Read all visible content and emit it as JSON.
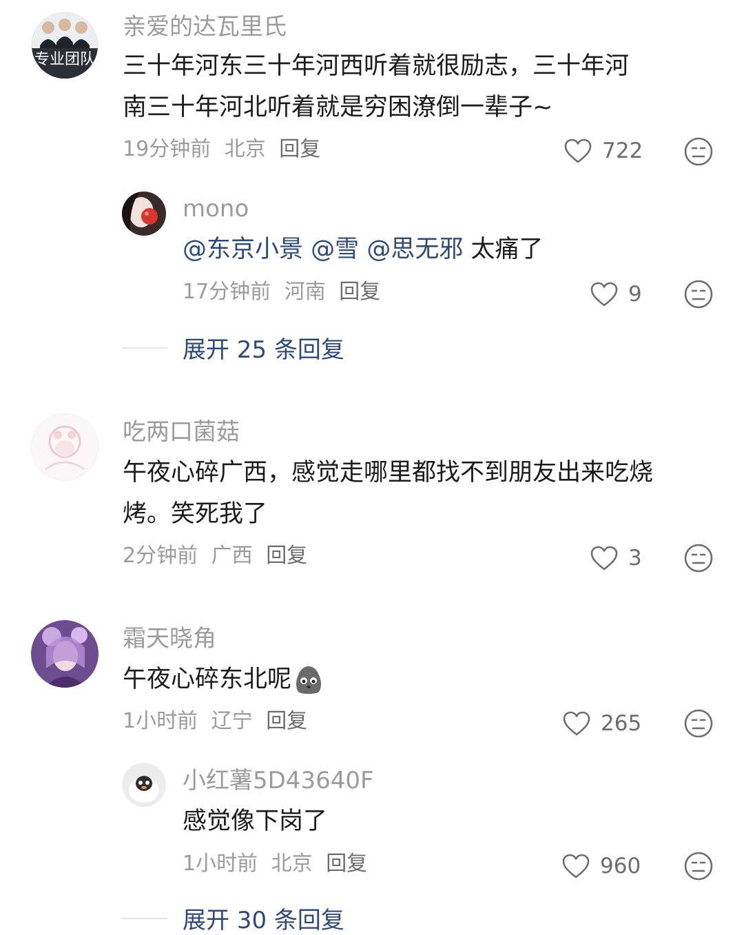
{
  "comments": [
    {
      "username": "亲爱的达瓦里氏",
      "avatar_text": "专业团队",
      "lines": [
        "三十年河东三十年河西听着就很励志，三十年河",
        "南三十年河北听着就是穷困潦倒一辈子~"
      ],
      "time": "19分钟前",
      "location": "北京",
      "reply_label": "回复",
      "likes": "722",
      "reply": {
        "username": "mono",
        "mentions": [
          "@东京小景",
          "@雪",
          "@思无邪"
        ],
        "text": "太痛了",
        "time": "17分钟前",
        "location": "河南",
        "reply_label": "回复",
        "likes": "9"
      },
      "expand_label": "展开 25 条回复"
    },
    {
      "username": "吃两口菌菇",
      "lines": [
        "午夜心碎广西，感觉走哪里都找不到朋友出来吃烧",
        "烤。笑死我了"
      ],
      "time": "2分钟前",
      "location": "广西",
      "reply_label": "回复",
      "likes": "3"
    },
    {
      "username": "霜天晓角",
      "lines": [
        "午夜心碎东北呢"
      ],
      "emoji": "sad-face-emoji",
      "time": "1小时前",
      "location": "辽宁",
      "reply_label": "回复",
      "likes": "265",
      "reply": {
        "username": "小红薯5D43640F",
        "text": "感觉像下岗了",
        "time": "1小时前",
        "location": "北京",
        "reply_label": "回复",
        "likes": "960"
      },
      "expand_label": "展开 30 条回复"
    }
  ],
  "icons": {
    "like": "heart-outline-icon",
    "dislike": "neutral-face-icon"
  },
  "colors": {
    "text": "#1b1b1b",
    "muted": "#9b9b9b",
    "link": "#2c4a7a",
    "background": "#ffffff"
  }
}
